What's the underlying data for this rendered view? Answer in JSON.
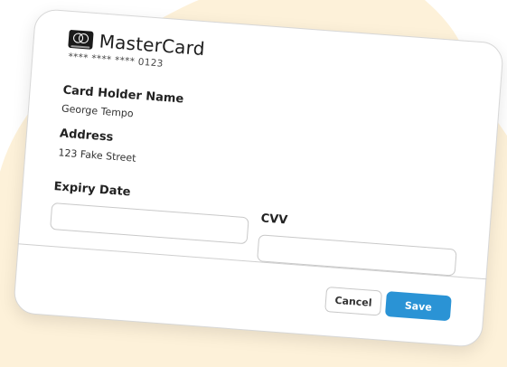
{
  "colors": {
    "backdrop": "#fdf1d9",
    "card_background": "#ffffff",
    "accent": "#2a93d5",
    "text": "#1c1c1c"
  },
  "card": {
    "brand_icon": "mastercard-logo-icon",
    "brand_name": "MasterCard",
    "masked_number": "**** **** **** 0123"
  },
  "fields": {
    "holder_label": "Card Holder Name",
    "holder_value": "George Tempo",
    "address_label": "Address",
    "address_value": "123 Fake Street",
    "expiry_label": "Expiry Date",
    "expiry_value": "",
    "cvv_label": "CVV",
    "cvv_value": ""
  },
  "actions": {
    "cancel_label": "Cancel",
    "save_label": "Save"
  }
}
